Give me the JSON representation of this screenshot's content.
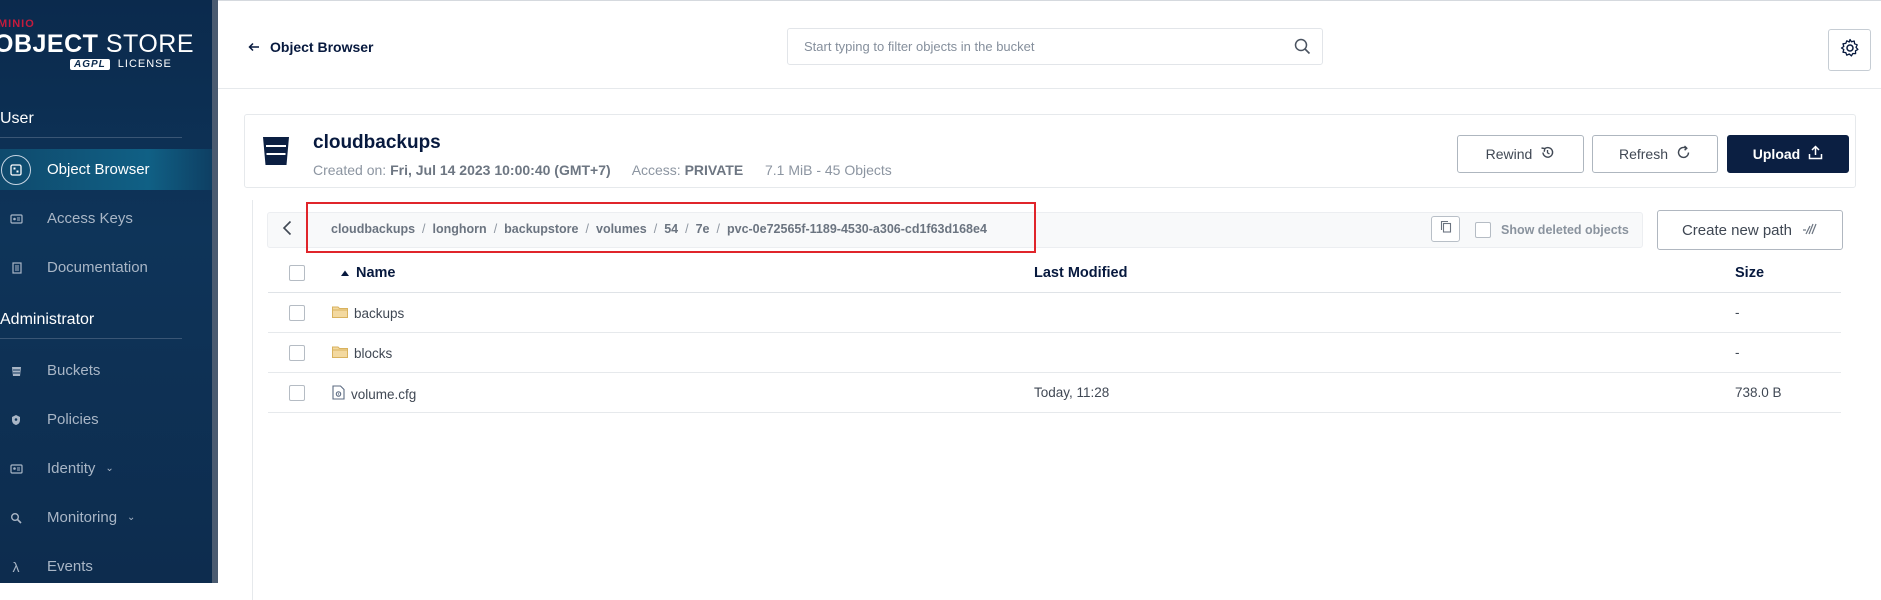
{
  "sidebar": {
    "brand": "MINIO",
    "product_bold": "OBJECT",
    "product_light": " STORE",
    "license_badge": "AGPL",
    "license_label": "LICENSE",
    "sections": {
      "user": "User",
      "administrator": "Administrator"
    },
    "user_items": [
      {
        "label": "Object Browser",
        "icon": "object-browser-icon",
        "active": true
      },
      {
        "label": "Access Keys",
        "icon": "access-keys-icon"
      },
      {
        "label": "Documentation",
        "icon": "documentation-icon"
      }
    ],
    "admin_items": [
      {
        "label": "Buckets",
        "icon": "buckets-icon"
      },
      {
        "label": "Policies",
        "icon": "policies-icon"
      },
      {
        "label": "Identity",
        "icon": "identity-icon",
        "expandable": true
      },
      {
        "label": "Monitoring",
        "icon": "monitoring-icon",
        "expandable": true
      },
      {
        "label": "Events",
        "icon": "lambda-icon"
      }
    ]
  },
  "header": {
    "back_label": "Object Browser",
    "search_placeholder": "Start typing to filter objects in the bucket"
  },
  "bucket": {
    "name": "cloudbackups",
    "created_label": "Created on:",
    "created_value": "Fri, Jul 14 2023 10:00:40 (GMT+7)",
    "access_label": "Access:",
    "access_value": "PRIVATE",
    "usage": "7.1 MiB - 45 Objects",
    "buttons": {
      "rewind": "Rewind",
      "refresh": "Refresh",
      "upload": "Upload"
    }
  },
  "path": {
    "segments": [
      "cloudbackups",
      "longhorn",
      "backupstore",
      "volumes",
      "54",
      "7e",
      "pvc-0e72565f-1189-4530-a306-cd1f63d168e4"
    ],
    "separator": "/",
    "show_deleted_label": "Show deleted objects",
    "create_path_label": "Create new path"
  },
  "table": {
    "columns": {
      "name": "Name",
      "modified": "Last Modified",
      "size": "Size"
    },
    "rows": [
      {
        "type": "folder",
        "name": "backups",
        "modified": "",
        "size": "-"
      },
      {
        "type": "folder",
        "name": "blocks",
        "modified": "",
        "size": "-"
      },
      {
        "type": "file",
        "name": "volume.cfg",
        "modified": "Today, 11:28",
        "size": "738.0 B"
      }
    ]
  },
  "colors": {
    "sidebar_bg": "#0e3459",
    "primary_button": "#0b1f42",
    "highlight_border": "#e0252b",
    "folder": "#e9c46a"
  }
}
